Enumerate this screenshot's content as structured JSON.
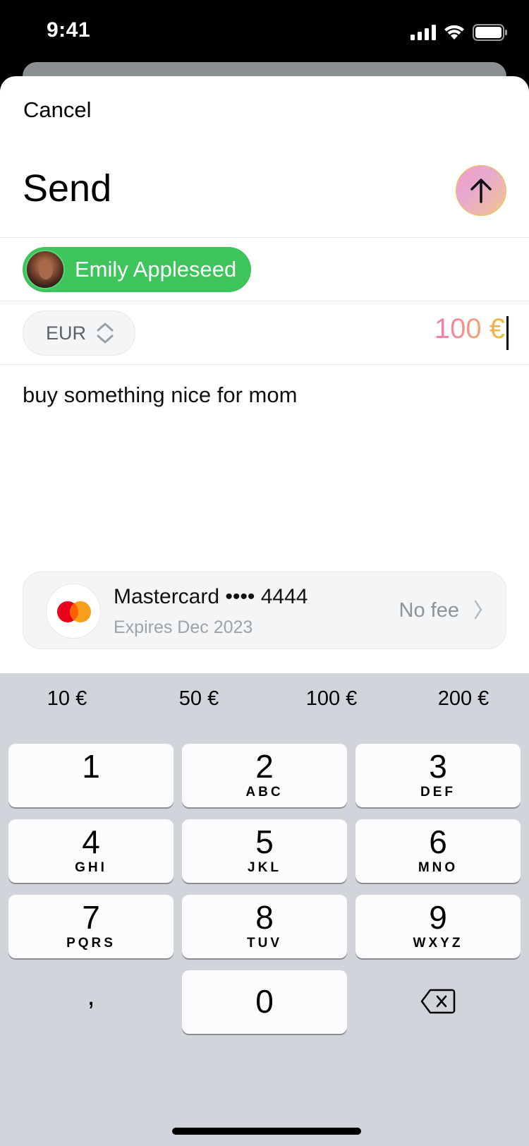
{
  "status_bar": {
    "time": "9:41"
  },
  "header": {
    "cancel_label": "Cancel",
    "title": "Send"
  },
  "recipient": {
    "name": "Emily Appleseed"
  },
  "currency": {
    "code": "EUR"
  },
  "amount": {
    "value": "100 €"
  },
  "note": {
    "text": "buy something nice for mom"
  },
  "payment_method": {
    "name": "Mastercard •••• 4444",
    "expiry": "Expires Dec 2023",
    "fee": "No fee"
  },
  "quick_amounts": [
    "10 €",
    "50 €",
    "100 €",
    "200 €"
  ],
  "keypad": {
    "keys": [
      {
        "num": "1",
        "letters": ""
      },
      {
        "num": "2",
        "letters": "ABC"
      },
      {
        "num": "3",
        "letters": "DEF"
      },
      {
        "num": "4",
        "letters": "GHI"
      },
      {
        "num": "5",
        "letters": "JKL"
      },
      {
        "num": "6",
        "letters": "MNO"
      },
      {
        "num": "7",
        "letters": "PQRS"
      },
      {
        "num": "8",
        "letters": "TUV"
      },
      {
        "num": "9",
        "letters": "WXYZ"
      },
      {
        "num": "0",
        "letters": ""
      }
    ],
    "decimal": ","
  },
  "colors": {
    "recipient_chip": "#3dc45b",
    "keyboard_bg": "#d1d4db",
    "amount_gradient_start": "#f07ab8",
    "amount_gradient_end": "#f2bd2f"
  },
  "icons": {
    "send": "arrow-up-icon",
    "currency": "chevron-up-down-icon",
    "card": "mastercard-logo-icon",
    "disclosure": "chevron-right-icon",
    "delete": "backspace-icon"
  }
}
